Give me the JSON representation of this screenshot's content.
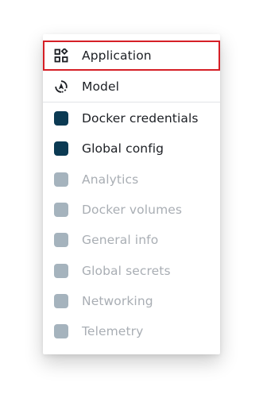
{
  "menu": {
    "top_items": [
      {
        "label": "Application",
        "icon": "grid-apps-icon",
        "selected": true
      },
      {
        "label": "Model",
        "icon": "model-cycle-icon",
        "selected": false
      }
    ],
    "config_items": [
      {
        "label": "Docker credentials",
        "color": "#0b3a53",
        "active": true
      },
      {
        "label": "Global config",
        "color": "#0b3a53",
        "active": true
      },
      {
        "label": "Analytics",
        "color": "#a5b3bd",
        "active": false
      },
      {
        "label": "Docker volumes",
        "color": "#a5b3bd",
        "active": false
      },
      {
        "label": "General info",
        "color": "#a5b3bd",
        "active": false
      },
      {
        "label": "Global secrets",
        "color": "#a5b3bd",
        "active": false
      },
      {
        "label": "Networking",
        "color": "#a5b3bd",
        "active": false
      },
      {
        "label": "Telemetry",
        "color": "#a5b3bd",
        "active": false
      }
    ]
  },
  "colors": {
    "selection_border": "#d61f26",
    "dark_text": "#1c1f24",
    "muted_text": "#a9aeb4"
  }
}
